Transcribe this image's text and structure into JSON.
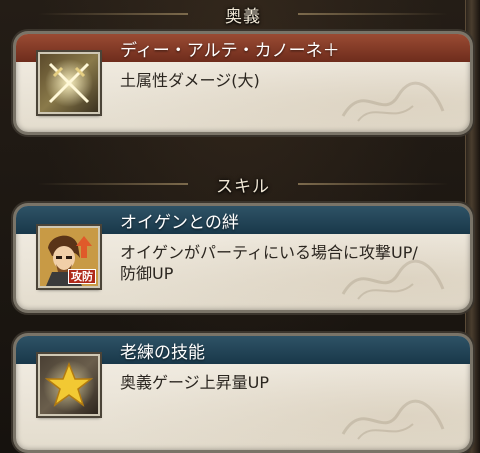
{
  "sections": {
    "ougi_header": "奥義",
    "skill_header": "スキル"
  },
  "ougi": {
    "name": "ディー・アルテ・カノーネ＋",
    "description": "土属性ダメージ(大)",
    "icon": "crossed-swords-icon"
  },
  "skills": [
    {
      "name": "オイゲンとの絆",
      "description_line1": "オイゲンがパーティにいる場合に攻撃UP/",
      "description_line2": "防御UP",
      "icon": "character-portrait-icon",
      "icon_badge": "攻防"
    },
    {
      "name": "老練の技能",
      "description_line1": "奥義ゲージ上昇量UP",
      "icon": "star-icon"
    }
  ],
  "colors": {
    "ougi_title_bar": "#8a3f29",
    "skill_title_bar": "#234559",
    "card_bg": "#efe9de"
  }
}
